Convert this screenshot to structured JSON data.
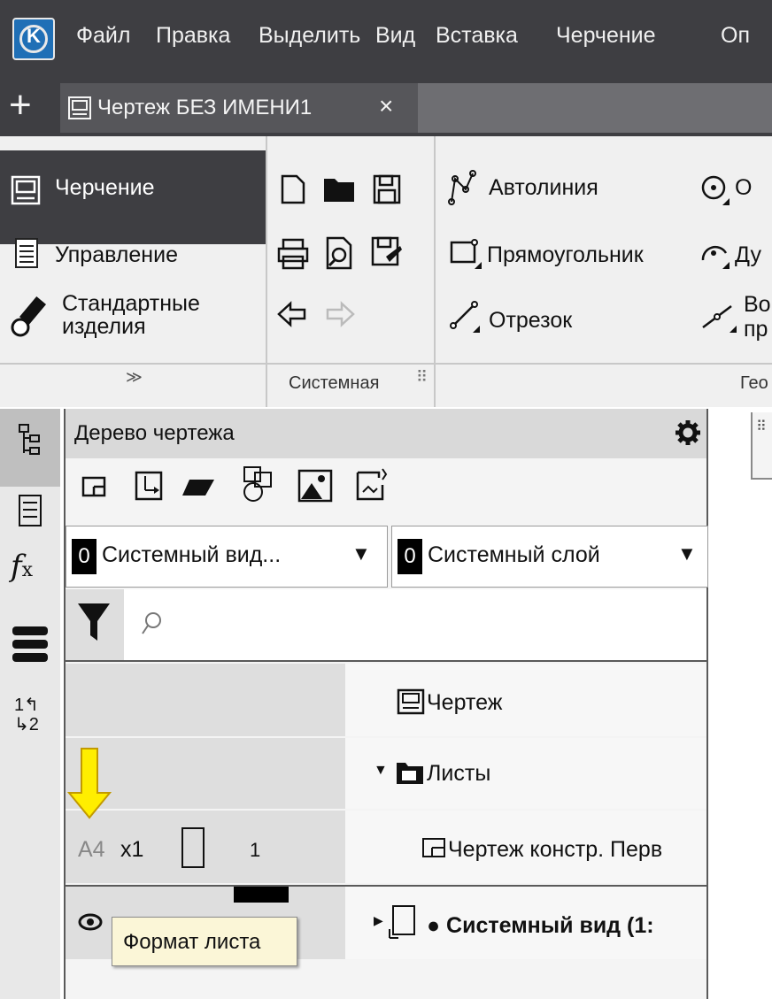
{
  "menu": {
    "items": [
      "Файл",
      "Правка",
      "Выделить",
      "Вид",
      "Вставка",
      "Черчение",
      "Оп"
    ]
  },
  "tabs": {
    "title": "Чертеж БЕЗ ИМЕНИ1",
    "close": "×",
    "plus": "+"
  },
  "ribbon": {
    "left_items": [
      "Черчение",
      "Управление",
      "Стандартные изделия"
    ],
    "std_line1": "Стандартные",
    "std_line2": "изделия",
    "expand": "≫",
    "system_group": "Системная",
    "geometry_items": [
      "Автолиния",
      "Прямоугольник",
      "Отрезок"
    ],
    "geometry_group": "Гео",
    "cut_items": [
      "О",
      "Ду",
      "Во",
      "пр"
    ]
  },
  "tree": {
    "title": "Дерево чертежа",
    "view_dd": {
      "num": "0",
      "label": "Системный вид...",
      "arrow": "▼"
    },
    "layer_dd": {
      "num": "0",
      "label": "Системный слой",
      "arrow": "▼"
    },
    "rows": {
      "drawing": "Чертеж",
      "sheets": "Листы",
      "sheet": "Чертеж констр. Перв",
      "sheet_format": "А4",
      "sheet_scale": "x1",
      "sheet_count": "1",
      "system_view": "Системный вид (1:"
    }
  },
  "tooltip": {
    "text": "Формат листа"
  },
  "colors": {
    "dark_bar": "#3e3e42",
    "ribbon_bg": "#f0f0f0",
    "arrow_yellow": "#ffee00",
    "tooltip_bg": "#fbf6d7"
  }
}
